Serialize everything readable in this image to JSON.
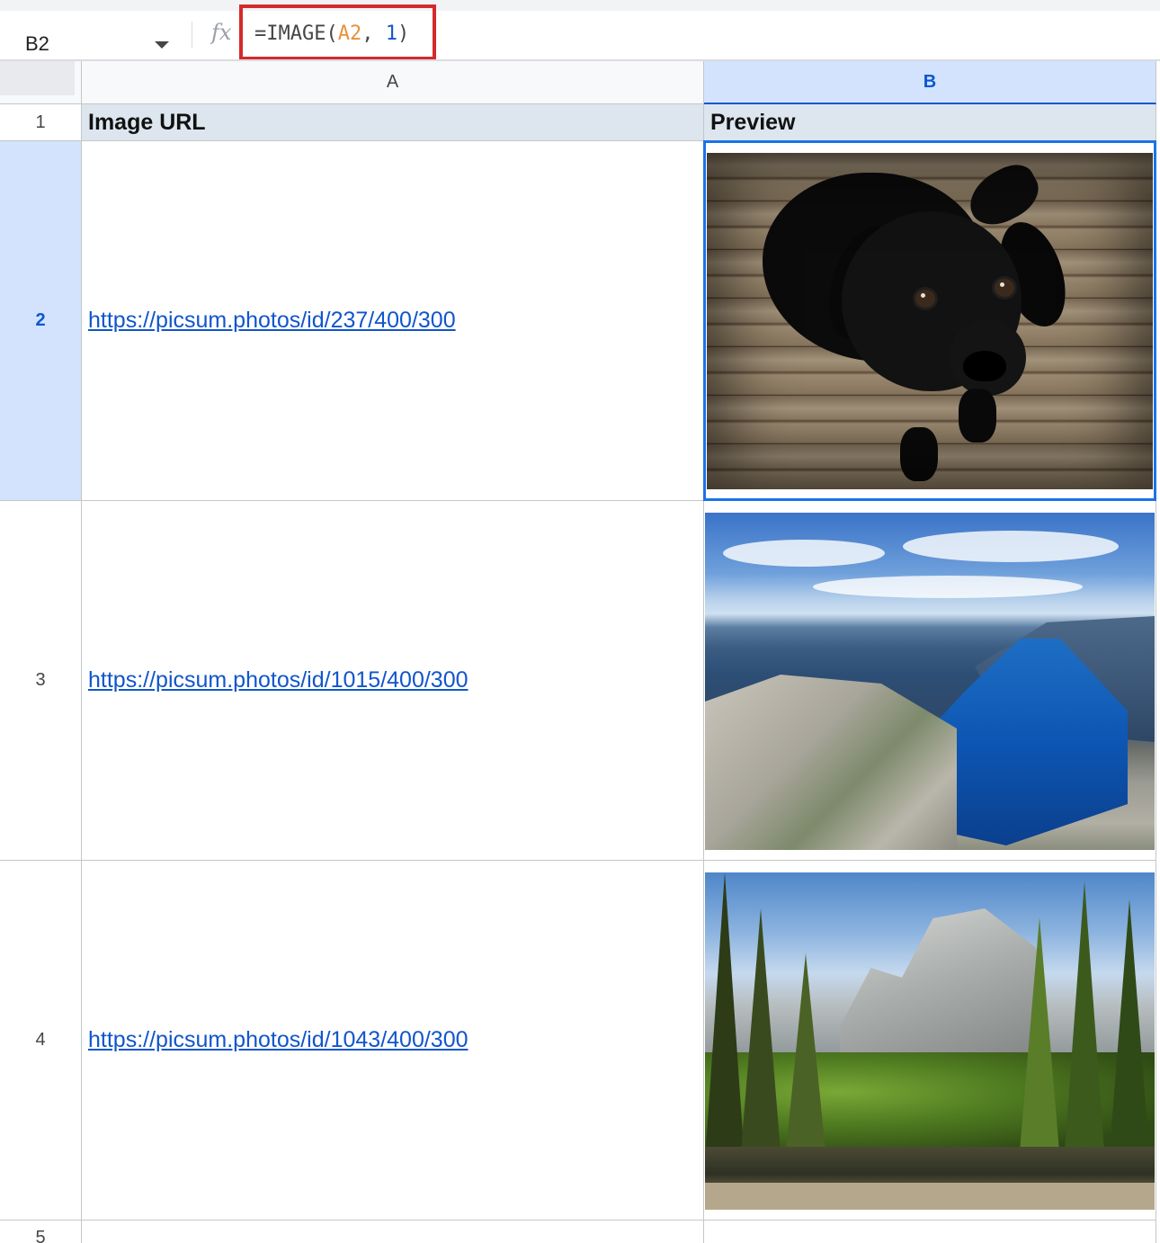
{
  "formula_bar": {
    "name_box": "B2",
    "fx_label": "fx",
    "formula": {
      "prefix": "=IMAGE(",
      "ref": "A2",
      "sep": ", ",
      "num": "1",
      "suffix": ")"
    },
    "highlight_color": "#d42a2a"
  },
  "columns": [
    {
      "label": "A",
      "selected": false
    },
    {
      "label": "B",
      "selected": true
    }
  ],
  "rows": [
    {
      "number": "1",
      "selected": false
    },
    {
      "number": "2",
      "selected": true
    },
    {
      "number": "3",
      "selected": false
    },
    {
      "number": "4",
      "selected": false
    },
    {
      "number": "5",
      "selected": false
    }
  ],
  "header_row": {
    "col_a": "Image URL",
    "col_b": "Preview"
  },
  "data_rows": [
    {
      "url": "https://picsum.photos/id/237/400/300",
      "preview": "black-puppy-on-wood-image"
    },
    {
      "url": "https://picsum.photos/id/1015/400/300",
      "preview": "fjord-landscape-image"
    },
    {
      "url": "https://picsum.photos/id/1043/400/300",
      "preview": "mountain-valley-forest-image"
    }
  ],
  "colors": {
    "selection_accent": "#1a73e8",
    "header_fill": "#dde6ee",
    "link": "#1155cc"
  }
}
